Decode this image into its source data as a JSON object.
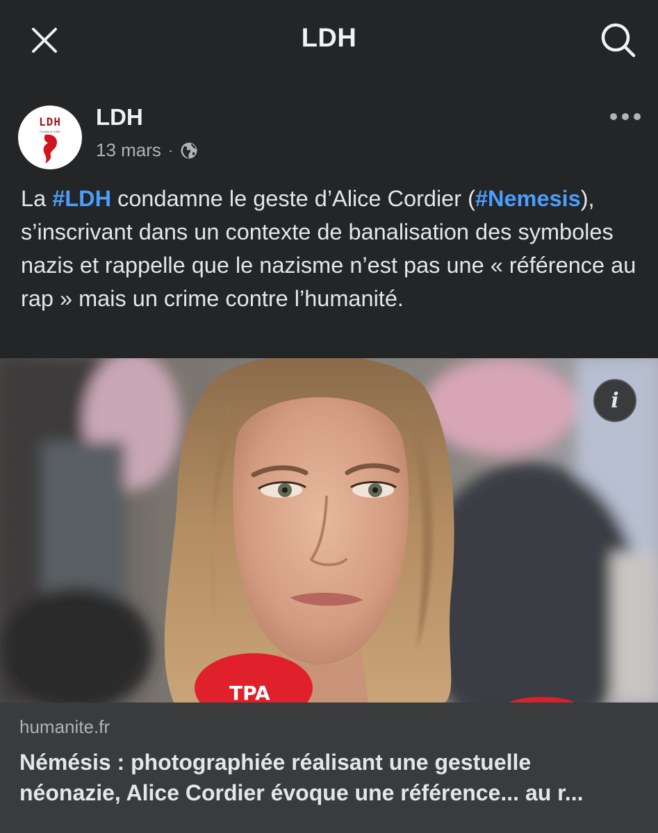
{
  "topbar": {
    "title": "LDH",
    "close_icon": "close-icon",
    "search_icon": "search-icon"
  },
  "post": {
    "author": "LDH",
    "avatar_text": "LDH",
    "avatar_subtext": "Fondée en 1898",
    "date": "13 mars",
    "separator": "·",
    "privacy_icon": "globe-icon",
    "more_icon": "more-horizontal-icon",
    "text": {
      "p1": "La ",
      "hashtag1": "#LDH",
      "p2": " condamne le geste d’Alice Cordier (",
      "hashtag2": "#Nemesis",
      "p3": "), s’inscrivant dans un contexte de banalisation des symboles nazis et rappelle que le nazisme n’est pas une « référence au rap » mais un crime contre l’humanité."
    }
  },
  "link_preview": {
    "image_alt": "Photo of a woman speaking to reporters in front of microphones",
    "info_icon": "info-icon",
    "info_label": "i",
    "domain": "humanite.fr",
    "headline_line1": "Némésis : photographiée réalisant une gestuelle",
    "headline_line2": "néonazie, Alice Cordier évoque une référence... au r..."
  },
  "colors": {
    "background": "#242526",
    "card": "#3a3b3c",
    "hashtag": "#4a9eff",
    "text": "#e4e6eb",
    "muted": "#b0b3b8"
  }
}
